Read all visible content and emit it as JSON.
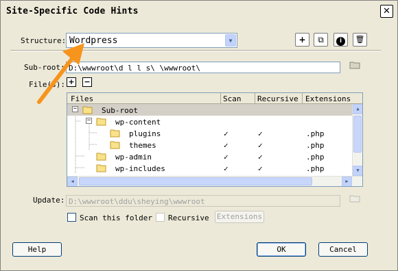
{
  "window": {
    "title": "Site-Specific Code Hints",
    "close_label": "✕"
  },
  "structure": {
    "label": "Structure:",
    "value": "Wordpress"
  },
  "toolbar": {
    "add_icon": "+",
    "copy_icon": "⧉",
    "info_icon": "i",
    "delete_icon": "🗑"
  },
  "subroot": {
    "label": "Sub-root:",
    "value": "D:\\wwwroot\\d   l  l s\\ \\wwwroot\\"
  },
  "files": {
    "label": "File(s):",
    "add_icon": "+",
    "remove_icon": "−"
  },
  "grid": {
    "headers": [
      "Files",
      "Scan",
      "Recursive",
      "Extensions"
    ],
    "rows": [
      {
        "name": "Sub-root",
        "scan": "",
        "recursive": "",
        "ext": ""
      },
      {
        "name": "wp-content",
        "scan": "",
        "recursive": "",
        "ext": ""
      },
      {
        "name": "plugins",
        "scan": "✓",
        "recursive": "✓",
        "ext": ".php"
      },
      {
        "name": "themes",
        "scan": "✓",
        "recursive": "✓",
        "ext": ".php"
      },
      {
        "name": "wp-admin",
        "scan": "✓",
        "recursive": "✓",
        "ext": ".php"
      },
      {
        "name": "wp-includes",
        "scan": "✓",
        "recursive": "✓",
        "ext": ".php"
      }
    ]
  },
  "update": {
    "label": "Update:",
    "value": "D:\\wwwroot\\ddu\\sheying\\wwwroot"
  },
  "options": {
    "scan_label": "Scan this folder",
    "recursive_label": "Recursive",
    "extensions_label": "Extensions"
  },
  "buttons": {
    "help": "Help",
    "ok": "OK",
    "cancel": "Cancel"
  },
  "colors": {
    "annotation_arrow": "#f7941d"
  }
}
